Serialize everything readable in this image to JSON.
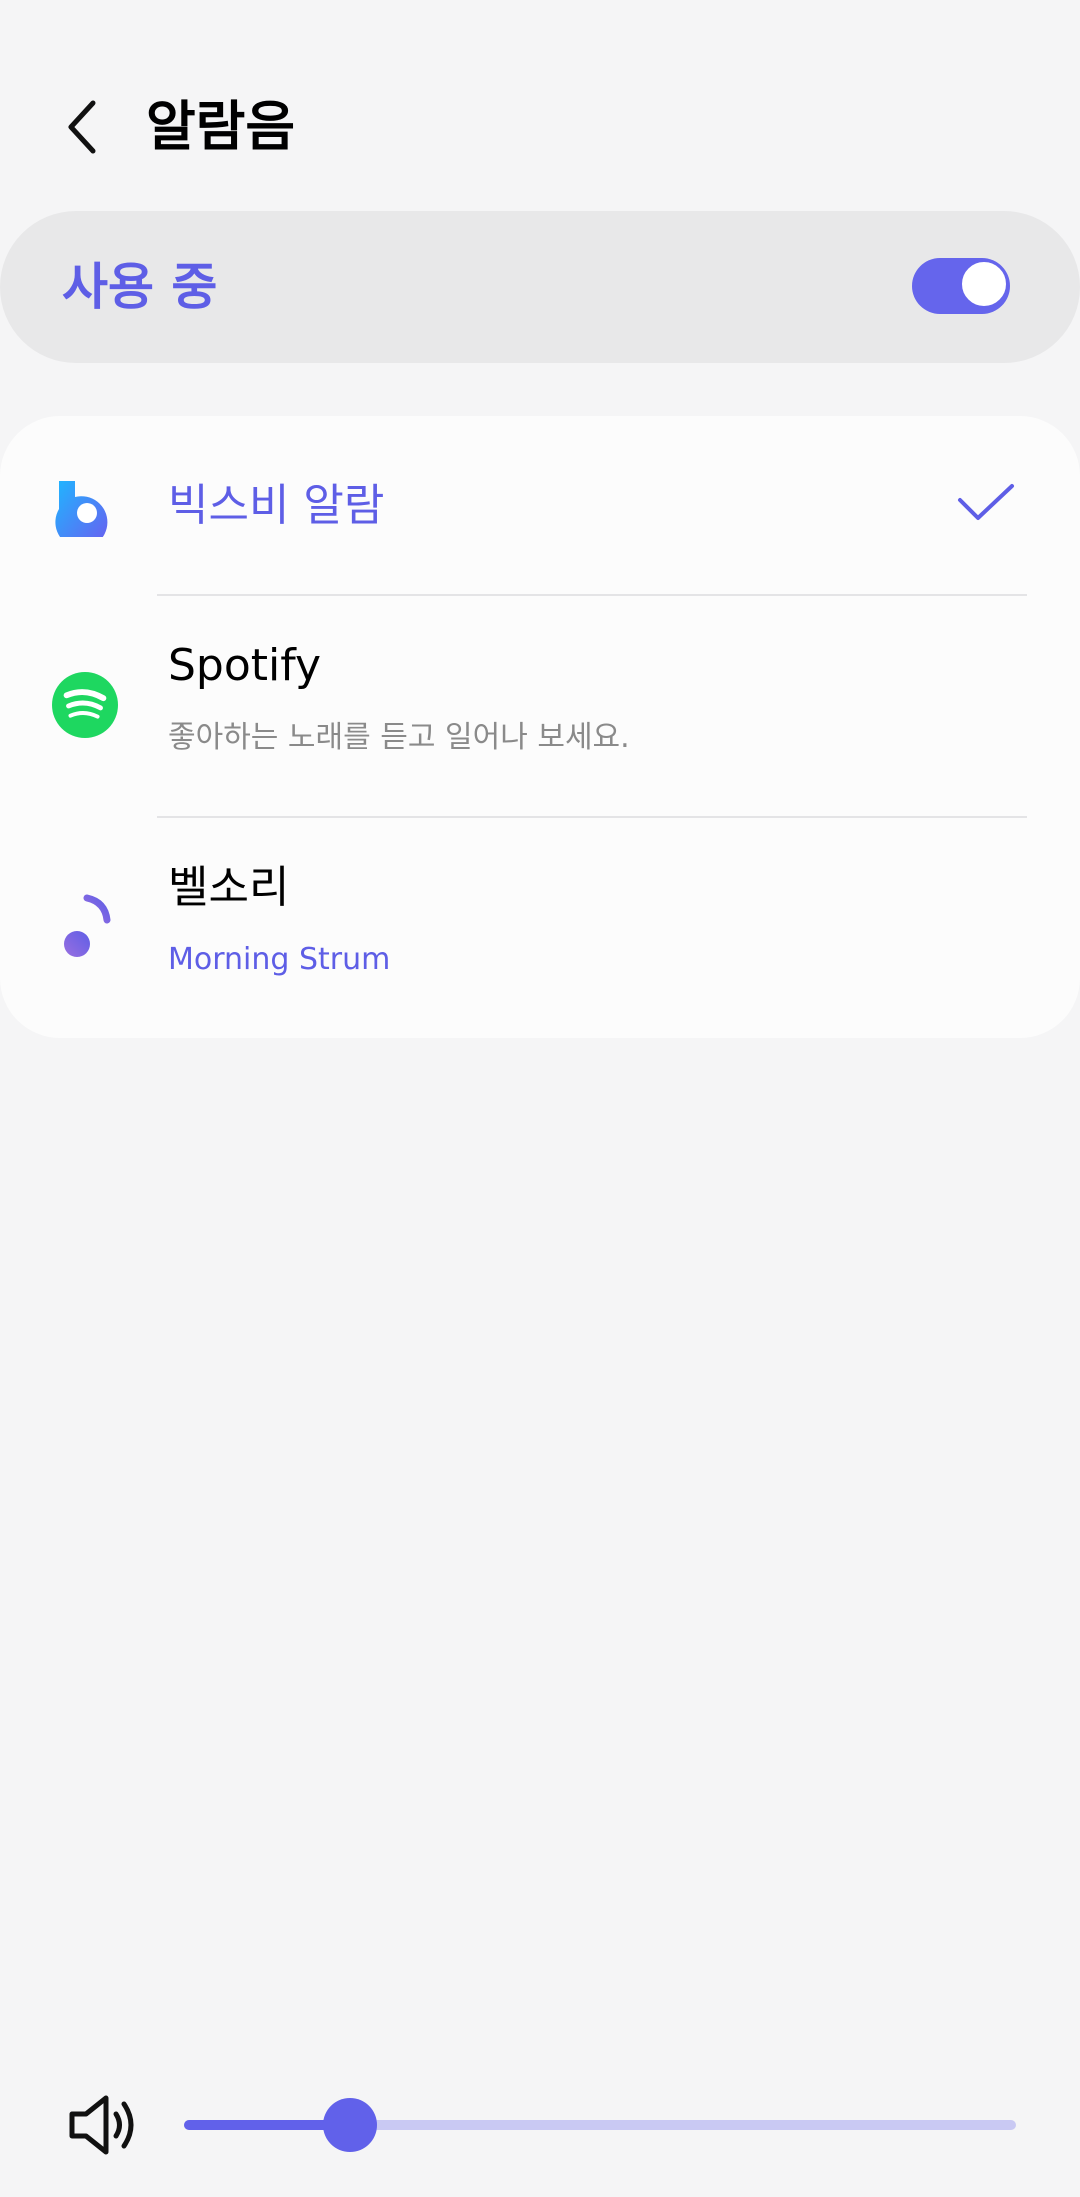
{
  "header": {
    "title": "알람음",
    "back_icon": "back-arrow-icon"
  },
  "master": {
    "label": "사용 중",
    "enabled": true,
    "accent_color": "#5e5ee6"
  },
  "sources": [
    {
      "title": "빅스비 알람",
      "subtitle": "",
      "icon": "bixby-icon",
      "selected": true
    },
    {
      "title": "Spotify",
      "subtitle": "좋아하는 노래를 듣고 일어나 보세요.",
      "icon": "spotify-icon",
      "selected": false
    },
    {
      "title": "벨소리",
      "subtitle": "Morning Strum",
      "icon": "music-note-icon",
      "selected": false
    }
  ],
  "volume": {
    "icon": "speaker-icon",
    "level": 0.2
  }
}
